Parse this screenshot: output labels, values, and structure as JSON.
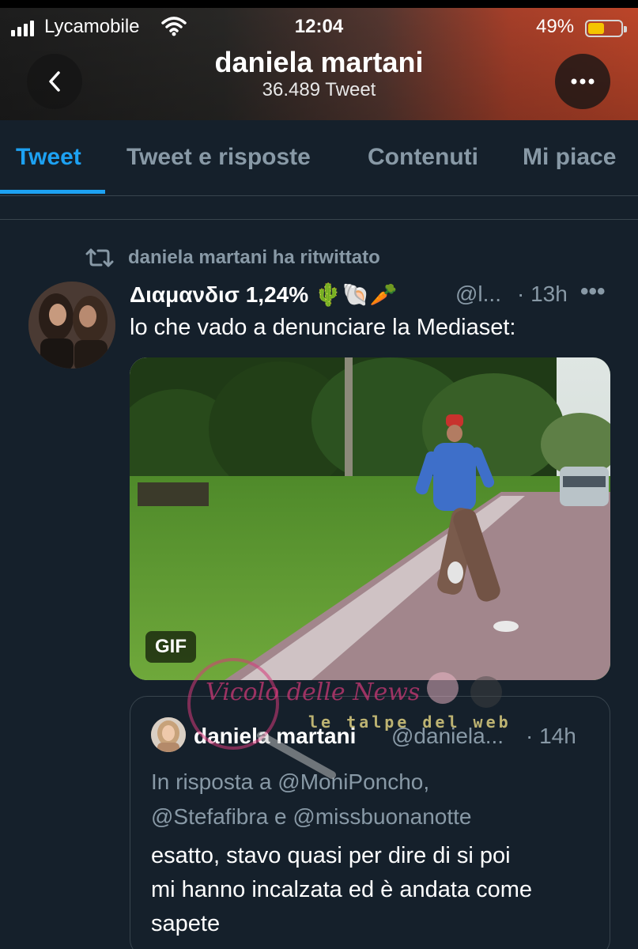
{
  "status_bar": {
    "carrier": "Lycamobile",
    "time": "12:04",
    "battery": "49%",
    "battery_level": 0.49
  },
  "profile": {
    "name": "daniela martani",
    "tweet_count": "36.489 Tweet"
  },
  "tabs": [
    {
      "label": "Tweet",
      "active": true
    },
    {
      "label": "Tweet e risposte",
      "active": false
    },
    {
      "label": "Contenuti",
      "active": false
    },
    {
      "label": "Mi piace",
      "active": false
    }
  ],
  "tweet": {
    "retweet_label": "daniela martani ha ritwittato",
    "author_name": "Διαμανδισ 1,24% 🌵🐚🥕",
    "handle": "@l...",
    "time": "· 13h",
    "more": "•••",
    "text": "lo che vado a denunciare la Mediaset:",
    "media_badge": "GIF"
  },
  "quote": {
    "author_name": "daniela martani",
    "handle": "@daniela...",
    "time": "· 14h",
    "reply_line1": "In risposta a @MoniPoncho,",
    "reply_line2": "@Stefafibra e @missbuonanotte",
    "text_line1": "esatto, stavo quasi per dire di si poi",
    "text_line2": "mi hanno incalzata ed è andata come",
    "text_line3": "sapete"
  },
  "watermark": {
    "text1": "Vicolo delle News",
    "text2": "le talpe del web"
  },
  "colors": {
    "background": "#15202b",
    "accent": "#1da1f2",
    "secondary_text": "#8899a6"
  }
}
